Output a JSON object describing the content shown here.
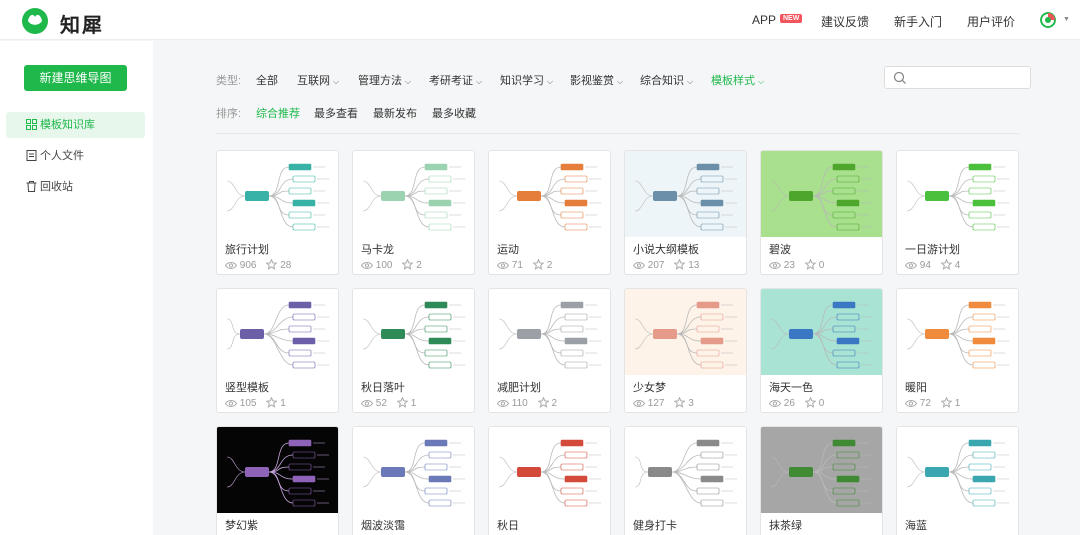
{
  "header": {
    "brand": "知犀",
    "app_label": "APP",
    "app_badge": "NEW",
    "links": [
      "建议反馈",
      "新手入门",
      "用户评价"
    ]
  },
  "sidebar": {
    "new_button": "新建思维导图",
    "items": [
      {
        "label": "模板知识库",
        "icon": "grid-icon",
        "active": true
      },
      {
        "label": "个人文件",
        "icon": "file-icon",
        "active": false
      },
      {
        "label": "回收站",
        "icon": "trash-icon",
        "active": false
      }
    ]
  },
  "filters": {
    "type_label": "类型:",
    "types": [
      {
        "label": "全部",
        "dropdown": false,
        "active": false
      },
      {
        "label": "互联网",
        "dropdown": true,
        "active": false
      },
      {
        "label": "管理方法",
        "dropdown": true,
        "active": false
      },
      {
        "label": "考研考证",
        "dropdown": true,
        "active": false
      },
      {
        "label": "知识学习",
        "dropdown": true,
        "active": false
      },
      {
        "label": "影视鉴赏",
        "dropdown": true,
        "active": false
      },
      {
        "label": "综合知识",
        "dropdown": true,
        "active": false
      },
      {
        "label": "模板样式",
        "dropdown": true,
        "active": true
      }
    ],
    "sort_label": "排序:",
    "sorts": [
      {
        "label": "综合推荐",
        "active": true
      },
      {
        "label": "最多查看",
        "active": false
      },
      {
        "label": "最新发布",
        "active": false
      },
      {
        "label": "最多收藏",
        "active": false
      }
    ],
    "search_placeholder": ""
  },
  "colors": {
    "accent": "#1fb84b",
    "badge": "#f2545b"
  },
  "cards": [
    {
      "title": "旅行计划",
      "views": "906",
      "stars": "28",
      "bg": "#ffffff",
      "style": "a"
    },
    {
      "title": "马卡龙",
      "views": "100",
      "stars": "2",
      "bg": "#ffffff",
      "style": "b"
    },
    {
      "title": "运动",
      "views": "71",
      "stars": "2",
      "bg": "#ffffff",
      "style": "c"
    },
    {
      "title": "小说大纲模板",
      "views": "207",
      "stars": "13",
      "bg": "#eef5f8",
      "style": "d"
    },
    {
      "title": "碧波",
      "views": "23",
      "stars": "0",
      "bg": "#a8e08e",
      "style": "e"
    },
    {
      "title": "一日游计划",
      "views": "94",
      "stars": "4",
      "bg": "#ffffff",
      "style": "f"
    },
    {
      "title": "竖型模板",
      "views": "105",
      "stars": "1",
      "bg": "#ffffff",
      "style": "g"
    },
    {
      "title": "秋日落叶",
      "views": "52",
      "stars": "1",
      "bg": "#ffffff",
      "style": "h"
    },
    {
      "title": "减肥计划",
      "views": "110",
      "stars": "2",
      "bg": "#ffffff",
      "style": "i"
    },
    {
      "title": "少女梦",
      "views": "127",
      "stars": "3",
      "bg": "#fdf3e8",
      "style": "j"
    },
    {
      "title": "海天一色",
      "views": "26",
      "stars": "0",
      "bg": "#a9e3d3",
      "style": "k"
    },
    {
      "title": "暖阳",
      "views": "72",
      "stars": "1",
      "bg": "#ffffff",
      "style": "l"
    },
    {
      "title": "梦幻紫",
      "views": "",
      "stars": "",
      "bg": "#050505",
      "style": "m"
    },
    {
      "title": "烟波淡霭",
      "views": "",
      "stars": "",
      "bg": "#ffffff",
      "style": "n"
    },
    {
      "title": "秋日",
      "views": "",
      "stars": "",
      "bg": "#ffffff",
      "style": "o"
    },
    {
      "title": "健身打卡",
      "views": "",
      "stars": "",
      "bg": "#ffffff",
      "style": "p"
    },
    {
      "title": "抹茶绿",
      "views": "",
      "stars": "",
      "bg": "#a6a6a6",
      "style": "q"
    },
    {
      "title": "海蓝",
      "views": "",
      "stars": "",
      "bg": "#ffffff",
      "style": "r"
    }
  ]
}
